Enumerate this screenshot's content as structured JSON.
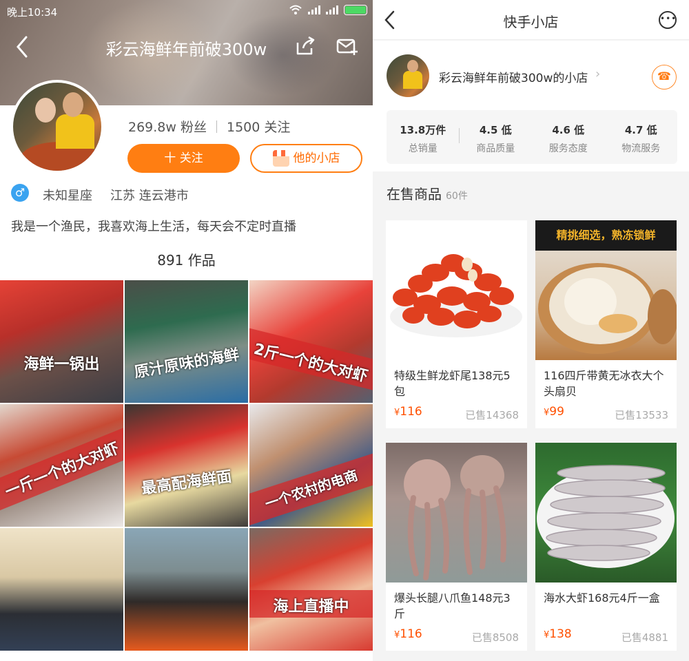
{
  "status_bar": {
    "time": "晚上10:34"
  },
  "profile": {
    "title": "彩云海鲜年前破300w",
    "followers": "269.8w 粉丝",
    "following": "1500 关注",
    "follow_label": "十 关注",
    "shop_label": "他的小店",
    "zodiac": "未知星座",
    "location": "江苏 连云港市",
    "bio": "我是一个渔民，我喜欢海上生活，每天会不定时直播",
    "works": "891 作品",
    "gender_symbol": "♂"
  },
  "videos": [
    {
      "caption": "海鲜一锅出"
    },
    {
      "caption": "原汁原味的海鲜"
    },
    {
      "caption": "2斤一个的大对虾"
    },
    {
      "caption": "一斤一个的大对虾"
    },
    {
      "caption": "最高配海鲜面"
    },
    {
      "caption": "一个农村的电商"
    },
    {
      "caption": ""
    },
    {
      "caption": ""
    },
    {
      "caption": "海上直播中"
    }
  ],
  "shop": {
    "page_title": "快手小店",
    "name": "彩云海鲜年前破300w的小店",
    "ratings": [
      {
        "value": "13.8万件",
        "label": "总销量"
      },
      {
        "value": "4.5 低",
        "label": "商品质量"
      },
      {
        "value": "4.6 低",
        "label": "服务态度"
      },
      {
        "value": "4.7 低",
        "label": "物流服务"
      }
    ],
    "section_title": "在售商品",
    "section_count": "60件",
    "products": [
      {
        "name": "特级生鲜龙虾尾138元5包",
        "price": "116",
        "sold": "已售14368"
      },
      {
        "name": "116四斤带黄无冰衣大个头扇贝",
        "price": "99",
        "sold": "已售13533",
        "banner": "精挑细选，熟冻锁鲜"
      },
      {
        "name": "爆头长腿八爪鱼148元3斤",
        "price": "116",
        "sold": "已售8508"
      },
      {
        "name": "海水大虾168元4斤一盒",
        "price": "138",
        "sold": "已售4881"
      }
    ],
    "currency": "¥"
  },
  "colors": {
    "accent": "#ff7e12",
    "price": "#ff5000"
  }
}
